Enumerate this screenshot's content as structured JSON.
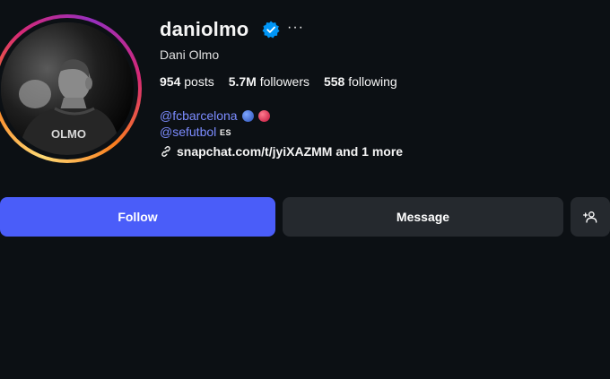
{
  "profile": {
    "username": "daniolmo",
    "more_label": "···",
    "full_name": "Dani Olmo",
    "jersey_text": "OLMO",
    "stats": {
      "posts_count": "954",
      "posts_label": "posts",
      "followers_count": "5.7M",
      "followers_label": "followers",
      "following_count": "558",
      "following_label": "following"
    },
    "bio": {
      "link1": "@fcbarcelona",
      "link2": "@sefutbol",
      "flag_code": "ES",
      "external_link": "snapchat.com/t/jyiXAZMM and 1 more"
    }
  },
  "actions": {
    "follow_label": "Follow",
    "message_label": "Message",
    "suggest_icon": "person-add-icon"
  },
  "colors": {
    "background": "#0c1014",
    "follow_button": "#4a5df9",
    "secondary_button": "#25292e",
    "link": "#7c8cff",
    "verified": "#0095f6"
  }
}
